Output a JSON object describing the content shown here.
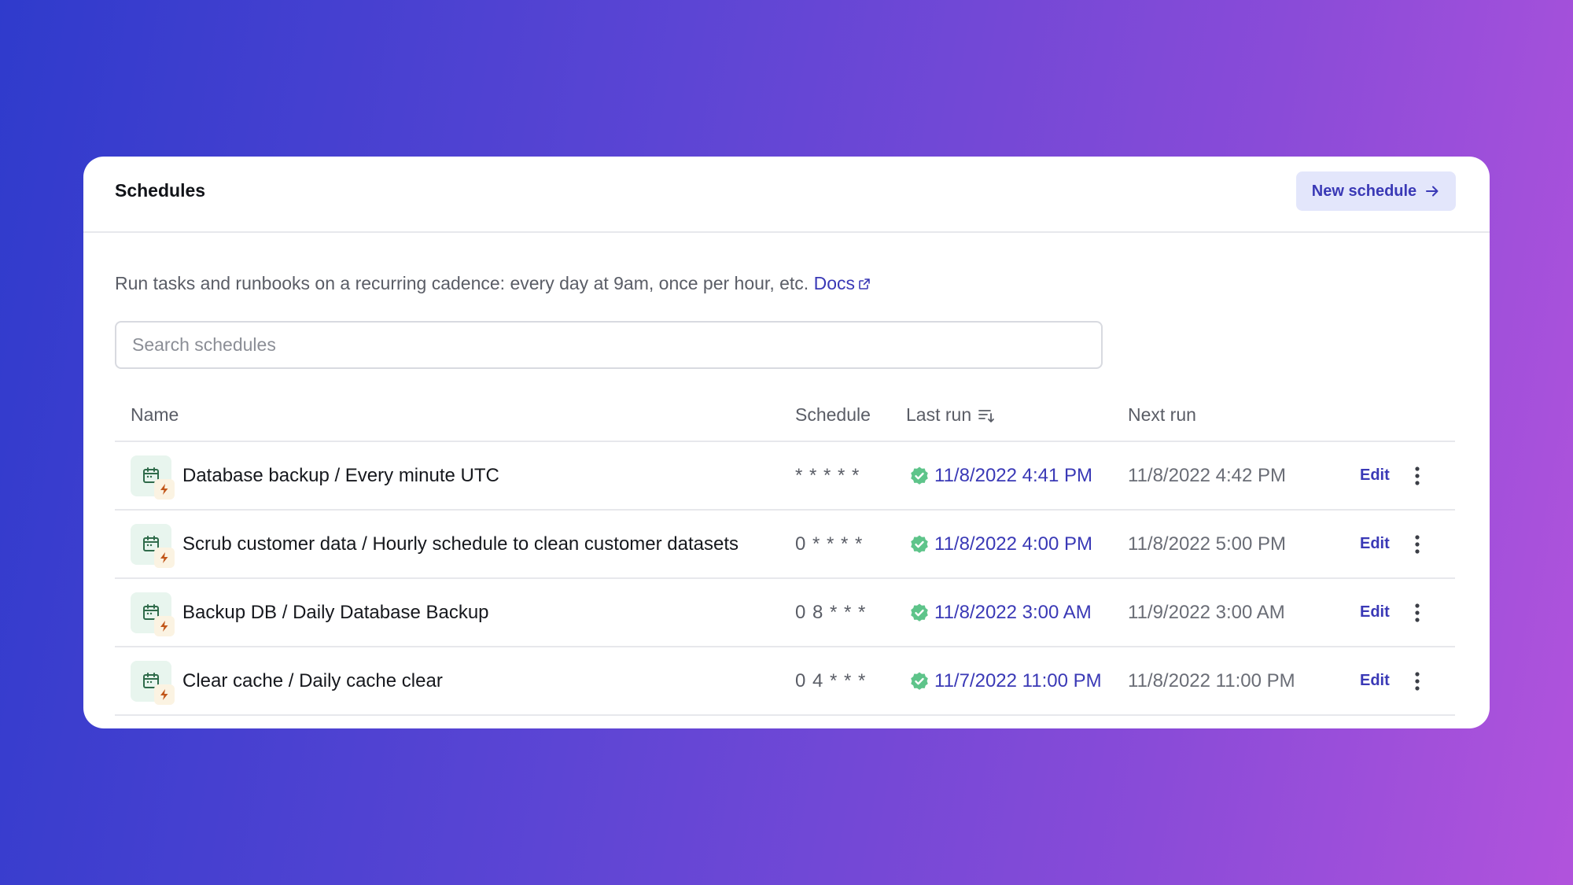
{
  "header": {
    "title": "Schedules",
    "new_button_label": "New schedule"
  },
  "description": {
    "text": "Run tasks and runbooks on a recurring cadence: every day at 9am, once per hour, etc.",
    "docs_link": "Docs"
  },
  "search": {
    "placeholder": "Search schedules",
    "value": ""
  },
  "table": {
    "columns": {
      "name": "Name",
      "schedule": "Schedule",
      "last_run": "Last run",
      "next_run": "Next run"
    },
    "rows": [
      {
        "name": "Database backup / Every minute UTC",
        "schedule": "* * * * *",
        "last_run": "11/8/2022 4:41 PM",
        "last_run_status": "success",
        "next_run": "11/8/2022 4:42 PM",
        "edit_label": "Edit"
      },
      {
        "name": "Scrub customer data / Hourly schedule to clean customer datasets",
        "schedule": "0 * * * *",
        "last_run": "11/8/2022 4:00 PM",
        "last_run_status": "success",
        "next_run": "11/8/2022 5:00 PM",
        "edit_label": "Edit"
      },
      {
        "name": "Backup DB / Daily Database Backup",
        "schedule": "0 8 * * *",
        "last_run": "11/8/2022 3:00 AM",
        "last_run_status": "success",
        "next_run": "11/9/2022 3:00 AM",
        "edit_label": "Edit"
      },
      {
        "name": "Clear cache / Daily cache clear",
        "schedule": "0 4 * * *",
        "last_run": "11/7/2022 11:00 PM",
        "last_run_status": "success",
        "next_run": "11/8/2022 11:00 PM",
        "edit_label": "Edit"
      }
    ]
  },
  "icons": {
    "row_icon": "calendar-bolt-icon",
    "status_icon": "check-badge-icon",
    "sort_icon": "sort-descending-icon",
    "more_icon": "vertical-dots-icon",
    "arrow_icon": "arrow-right-icon",
    "external_icon": "external-link-icon"
  },
  "colors": {
    "accent": "#3a39b6",
    "success": "#5ec48a",
    "icon_bg": "#e8f5ee",
    "bolt": "#c2571a"
  }
}
